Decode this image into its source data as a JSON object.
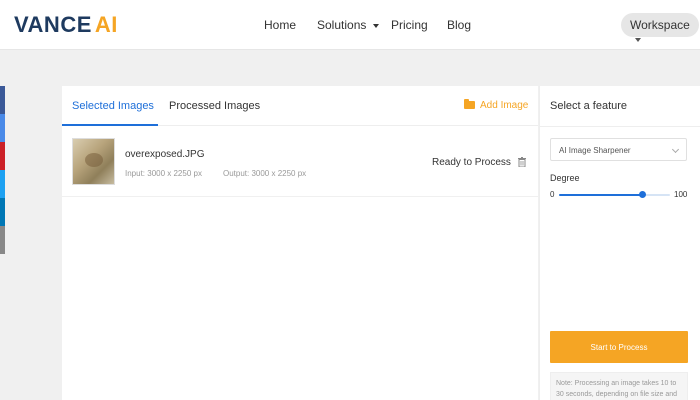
{
  "brand": {
    "part1": "VANCE",
    "part2": "AI"
  },
  "nav": {
    "home": "Home",
    "solutions": "Solutions",
    "pricing": "Pricing",
    "blog": "Blog",
    "workspace": "Workspace"
  },
  "social_colors": [
    "#3b5998",
    "#4a8ae8",
    "#cb2027",
    "#1da1f2",
    "#0077b5",
    "#888888"
  ],
  "tabs": {
    "selected": "Selected Images",
    "processed": "Processed Images",
    "add_image": "Add Image"
  },
  "file": {
    "name": "overexposed.JPG",
    "input": "Input: 3000 x 2250 px",
    "output": "Output: 3000 x 2250 px",
    "status": "Ready to Process"
  },
  "panel": {
    "title": "Select a feature",
    "feature": "AI Image Sharpener",
    "degree_label": "Degree",
    "degree_min": "0",
    "degree_max": "100",
    "degree_value": 75,
    "start_button": "Start to Process",
    "note": "Note: Processing an image takes 10 to 30 seconds, depending on file size and"
  },
  "colors": {
    "accent": "#f5a524",
    "primary": "#1e6fd9",
    "logo_dark": "#1e3a5f"
  }
}
